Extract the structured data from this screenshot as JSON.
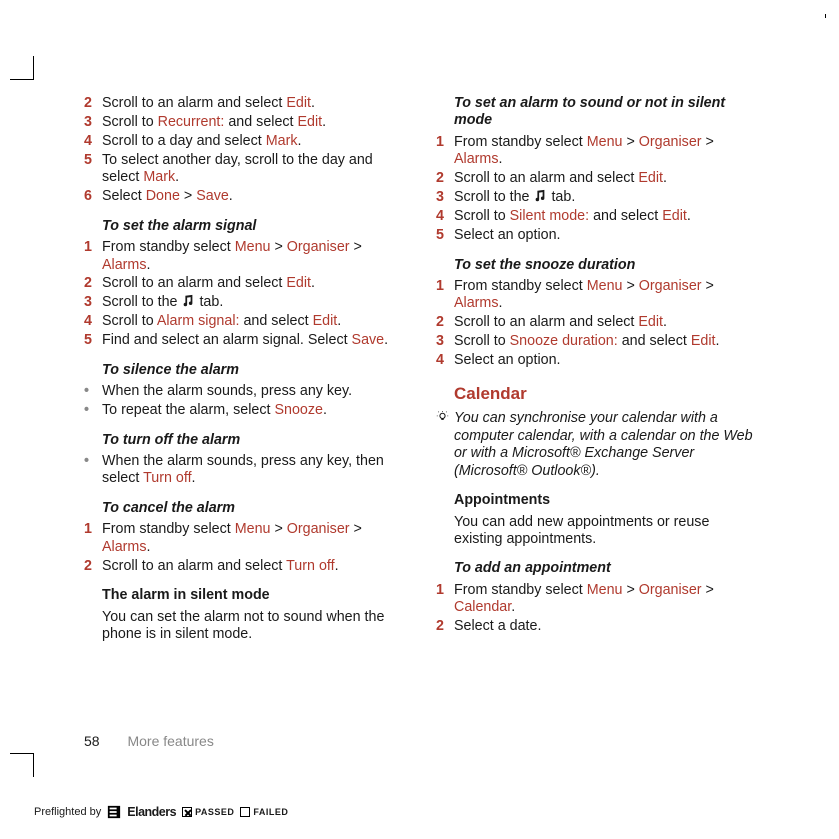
{
  "footer": {
    "page": "58",
    "section": "More features"
  },
  "icons": {
    "music_note_alt": "music tab",
    "tip": "💡"
  },
  "preflight": {
    "label": "Preflighted by",
    "brand": "Elanders",
    "passed": "PASSED",
    "failed": "FAILED"
  },
  "left": {
    "steps_a": [
      {
        "n": "2",
        "parts": [
          "Scroll to an alarm and select ",
          {
            "ui": "Edit"
          },
          "."
        ]
      },
      {
        "n": "3",
        "parts": [
          "Scroll to ",
          {
            "ui": "Recurrent:"
          },
          " and select ",
          {
            "ui": "Edit"
          },
          "."
        ]
      },
      {
        "n": "4",
        "parts": [
          "Scroll to a day and select ",
          {
            "ui": "Mark"
          },
          "."
        ]
      },
      {
        "n": "5",
        "parts": [
          "To select another day, scroll to the day and select ",
          {
            "ui": "Mark"
          },
          "."
        ]
      },
      {
        "n": "6",
        "parts": [
          "Select ",
          {
            "ui": "Done"
          },
          " > ",
          {
            "ui": "Save"
          },
          "."
        ]
      }
    ],
    "h1": "To set the alarm signal",
    "steps_b": [
      {
        "n": "1",
        "parts": [
          "From standby select ",
          {
            "ui": "Menu"
          },
          " > ",
          {
            "ui": "Organiser"
          },
          " > ",
          {
            "ui": "Alarms"
          },
          "."
        ]
      },
      {
        "n": "2",
        "parts": [
          "Scroll to an alarm and select ",
          {
            "ui": "Edit"
          },
          "."
        ]
      },
      {
        "n": "3",
        "parts": [
          "Scroll to the ",
          {
            "icon": "music"
          },
          " tab."
        ]
      },
      {
        "n": "4",
        "parts": [
          "Scroll to ",
          {
            "ui": "Alarm signal:"
          },
          " and select ",
          {
            "ui": "Edit"
          },
          "."
        ]
      },
      {
        "n": "5",
        "parts": [
          "Find and select an alarm signal. Select ",
          {
            "ui": "Save"
          },
          "."
        ]
      }
    ],
    "h2": "To silence the alarm",
    "bullets_a": [
      {
        "parts": [
          "When the alarm sounds, press any key."
        ]
      },
      {
        "parts": [
          "To repeat the alarm, select ",
          {
            "ui": "Snooze"
          },
          "."
        ]
      }
    ],
    "h3": "To turn off the alarm",
    "bullets_b": [
      {
        "parts": [
          "When the alarm sounds, press any key, then select ",
          {
            "ui": "Turn off"
          },
          "."
        ]
      }
    ],
    "h4": "To cancel the alarm",
    "steps_c": [
      {
        "n": "1",
        "parts": [
          "From standby select ",
          {
            "ui": "Menu"
          },
          " > ",
          {
            "ui": "Organiser"
          },
          " > ",
          {
            "ui": "Alarms"
          },
          "."
        ]
      },
      {
        "n": "2",
        "parts": [
          "Scroll to an alarm and select ",
          {
            "ui": "Turn off"
          },
          "."
        ]
      }
    ],
    "h5": "The alarm in silent mode",
    "p5": "You can set the alarm not to sound when the phone is in silent mode."
  },
  "right": {
    "h1": "To set an alarm to sound or not in silent mode",
    "steps_a": [
      {
        "n": "1",
        "parts": [
          "From standby select ",
          {
            "ui": "Menu"
          },
          " > ",
          {
            "ui": "Organiser"
          },
          " > ",
          {
            "ui": "Alarms"
          },
          "."
        ]
      },
      {
        "n": "2",
        "parts": [
          "Scroll to an alarm and select ",
          {
            "ui": "Edit"
          },
          "."
        ]
      },
      {
        "n": "3",
        "parts": [
          "Scroll to the ",
          {
            "icon": "music"
          },
          " tab."
        ]
      },
      {
        "n": "4",
        "parts": [
          "Scroll to ",
          {
            "ui": "Silent mode:"
          },
          " and select ",
          {
            "ui": "Edit"
          },
          "."
        ]
      },
      {
        "n": "5",
        "parts": [
          "Select an option."
        ]
      }
    ],
    "h2": "To set the snooze duration",
    "steps_b": [
      {
        "n": "1",
        "parts": [
          "From standby select ",
          {
            "ui": "Menu"
          },
          " > ",
          {
            "ui": "Organiser"
          },
          " > ",
          {
            "ui": "Alarms"
          },
          "."
        ]
      },
      {
        "n": "2",
        "parts": [
          "Scroll to an alarm and select ",
          {
            "ui": "Edit"
          },
          "."
        ]
      },
      {
        "n": "3",
        "parts": [
          "Scroll to ",
          {
            "ui": "Snooze duration:"
          },
          " and select ",
          {
            "ui": "Edit"
          },
          "."
        ]
      },
      {
        "n": "4",
        "parts": [
          "Select an option."
        ]
      }
    ],
    "section": "Calendar",
    "tip": "You can synchronise your calendar with a computer calendar, with a calendar on the Web or with a Microsoft® Exchange Server (Microsoft® Outlook®).",
    "h3": "Appointments",
    "p3": "You can add new appointments or reuse existing appointments.",
    "h4": "To add an appointment",
    "steps_c": [
      {
        "n": "1",
        "parts": [
          "From standby select ",
          {
            "ui": "Menu"
          },
          " > ",
          {
            "ui": "Organiser"
          },
          " > ",
          {
            "ui": "Calendar"
          },
          "."
        ]
      },
      {
        "n": "2",
        "parts": [
          "Select a date."
        ]
      }
    ]
  }
}
